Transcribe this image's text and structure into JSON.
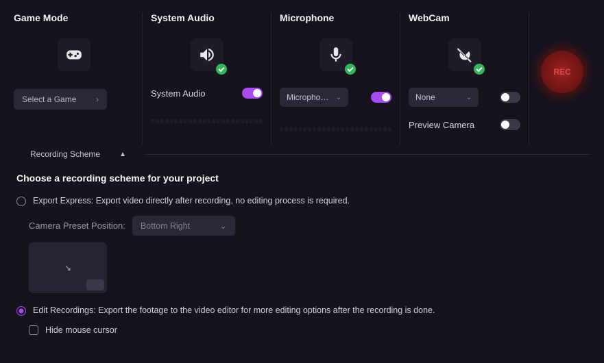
{
  "panels": {
    "game": {
      "title": "Game Mode",
      "select_label": "Select a Game"
    },
    "sys_audio": {
      "title": "System Audio",
      "toggle_label": "System Audio",
      "toggle_on": true
    },
    "mic": {
      "title": "Microphone",
      "dd_value": "Microphone A",
      "toggle_on": true
    },
    "webcam": {
      "title": "WebCam",
      "dd_value": "None",
      "toggle_on": false,
      "preview_label": "Preview Camera",
      "preview_on": false
    }
  },
  "rec": {
    "label": "REC"
  },
  "scheme": {
    "header": "Recording Scheme",
    "title": "Choose a recording scheme for your project",
    "export": {
      "label": "Export Express: Export video directly after recording, no editing process is required.",
      "selected": false
    },
    "preset": {
      "label": "Camera Preset Position:",
      "value": "Bottom Right"
    },
    "edit": {
      "label": "Edit Recordings: Export the footage to the video editor for more editing options after the recording is done.",
      "selected": true
    },
    "hide_cursor": {
      "label": "Hide mouse cursor",
      "checked": false
    }
  }
}
